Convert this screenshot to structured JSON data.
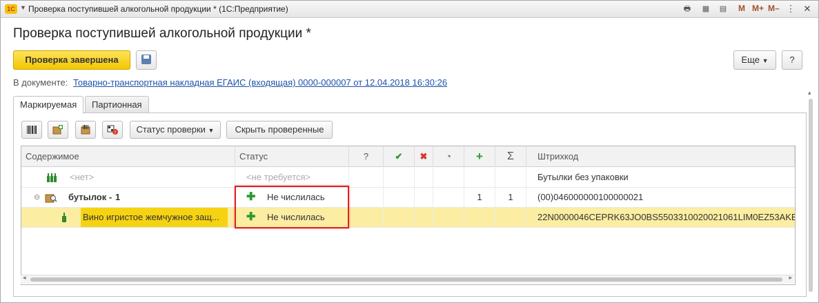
{
  "window": {
    "title": "Проверка поступившей алкогольной продукции * (1С:Предприятие)",
    "app_logo": "1С",
    "m_buttons": [
      "M",
      "M+",
      "M–"
    ]
  },
  "page": {
    "title": "Проверка поступившей алкогольной продукции *"
  },
  "toolbar": {
    "complete_label": "Проверка завершена",
    "more_label": "Еще",
    "help_label": "?"
  },
  "document": {
    "label": "В документе:",
    "link": "Товарно-транспортная накладная ЕГАИС (входящая) 0000-000007 от 12.04.2018 16:30:26"
  },
  "tabs": [
    {
      "label": "Маркируемая",
      "active": true
    },
    {
      "label": "Партионная",
      "active": false
    }
  ],
  "grid_toolbar": {
    "status_label": "Статус проверки",
    "hide_label": "Скрыть проверенные"
  },
  "grid": {
    "headers": {
      "content": "Содержимое",
      "status": "Статус",
      "question": "?",
      "checked": "✔",
      "error": "✖",
      "clock": "◔",
      "added": "+",
      "sum": "Σ",
      "barcode": "Штрихкод"
    },
    "rows": [
      {
        "content": "<нет>",
        "status": "<не требуется>",
        "qty_plus": "",
        "qty_sum": "",
        "barcode": "Бутылки без упаковки"
      },
      {
        "content": "бутылок -",
        "count": "1",
        "status": "Не числилась",
        "qty_plus": "1",
        "qty_sum": "1",
        "barcode": "(00)046000000100000021"
      },
      {
        "content": "Вино игристое жемчужное защ...",
        "status": "Не числилась",
        "qty_plus": "",
        "qty_sum": "",
        "barcode": "22N0000046CEPRK63JO0BS5503310020021061LIM0EZ53AKE"
      }
    ]
  }
}
